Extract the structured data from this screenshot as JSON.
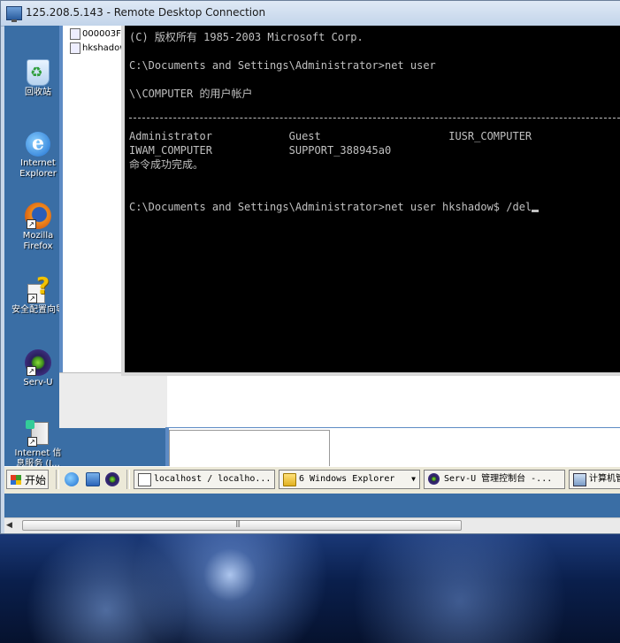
{
  "rdp": {
    "title": "125.208.5.143 - Remote Desktop Connection"
  },
  "desktop_icons": [
    {
      "label": "回收站"
    },
    {
      "label": "Internet Explorer"
    },
    {
      "label": "Mozilla Firefox"
    },
    {
      "label": "安全配置向导"
    },
    {
      "label": "Serv-U"
    },
    {
      "label": "Internet 信息服务 (I..."
    }
  ],
  "explorer": {
    "files": [
      "000003F0",
      "hkshadow"
    ]
  },
  "cmd": {
    "lines": [
      "(C) 版权所有 1985-2003 Microsoft Corp.",
      "C:\\Documents and Settings\\Administrator>net user",
      "\\\\COMPUTER 的用户帐户",
      "Administrator            Guest                    IUSR_COMPUTER",
      "IWAM_COMPUTER            SUPPORT_388945a0",
      "命令成功完成。",
      "C:\\Documents and Settings\\Administrator>net user hkshadow$ /del"
    ]
  },
  "taskbar": {
    "start_label": "开始",
    "tasks": [
      {
        "label": "localhost / localho..."
      },
      {
        "label": "6 Windows Explorer"
      },
      {
        "label": "Serv-U 管理控制台 -..."
      },
      {
        "label": "计算机管"
      }
    ]
  }
}
